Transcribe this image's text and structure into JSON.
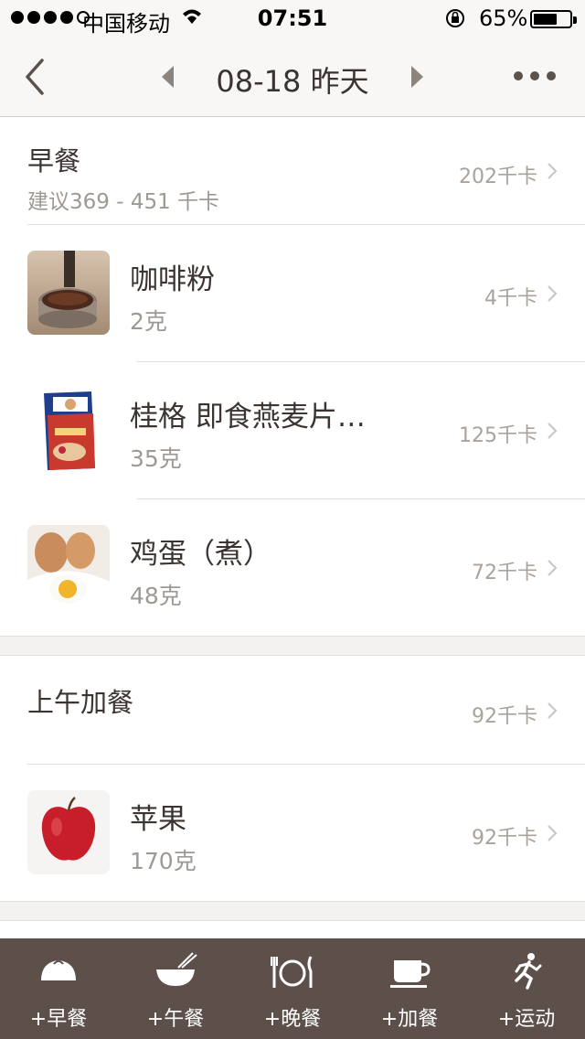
{
  "status_bar": {
    "carrier": "中国移动",
    "time": "07:51",
    "battery_percent": "65%",
    "battery_level": 0.65,
    "signal_bars": 4
  },
  "nav": {
    "title": "08-18 昨天",
    "icons": [
      "back-chevron-icon",
      "prev-day-icon",
      "next-day-icon",
      "more-icon"
    ]
  },
  "meals": [
    {
      "name": "早餐",
      "suggestion": "建议369 - 451 千卡",
      "kcal": "202千卡",
      "items": [
        {
          "name": "咖啡粉",
          "amount": "2克",
          "kcal": "4千卡",
          "icon": "coffee-powder-image"
        },
        {
          "name": "桂格 即食燕麦片…",
          "amount": "35克",
          "kcal": "125千卡",
          "icon": "oatmeal-box-image"
        },
        {
          "name": "鸡蛋（煮）",
          "amount": "48克",
          "kcal": "72千卡",
          "icon": "boiled-egg-image"
        }
      ]
    },
    {
      "name": "上午加餐",
      "suggestion": "",
      "kcal": "92千卡",
      "items": [
        {
          "name": "苹果",
          "amount": "170克",
          "kcal": "92千卡",
          "icon": "apple-image"
        }
      ]
    }
  ],
  "tabs": [
    {
      "label": "+早餐",
      "icon": "bun-icon"
    },
    {
      "label": "+午餐",
      "icon": "bowl-chopsticks-icon"
    },
    {
      "label": "+晚餐",
      "icon": "plate-cutlery-icon"
    },
    {
      "label": "+加餐",
      "icon": "coffee-cup-icon"
    },
    {
      "label": "+运动",
      "icon": "runner-icon"
    }
  ],
  "colors": {
    "tab_bar_bg": "#5d504a",
    "nav_bg": "#f8f7f5",
    "text_primary": "#3b3431",
    "text_secondary": "#9f9994"
  }
}
